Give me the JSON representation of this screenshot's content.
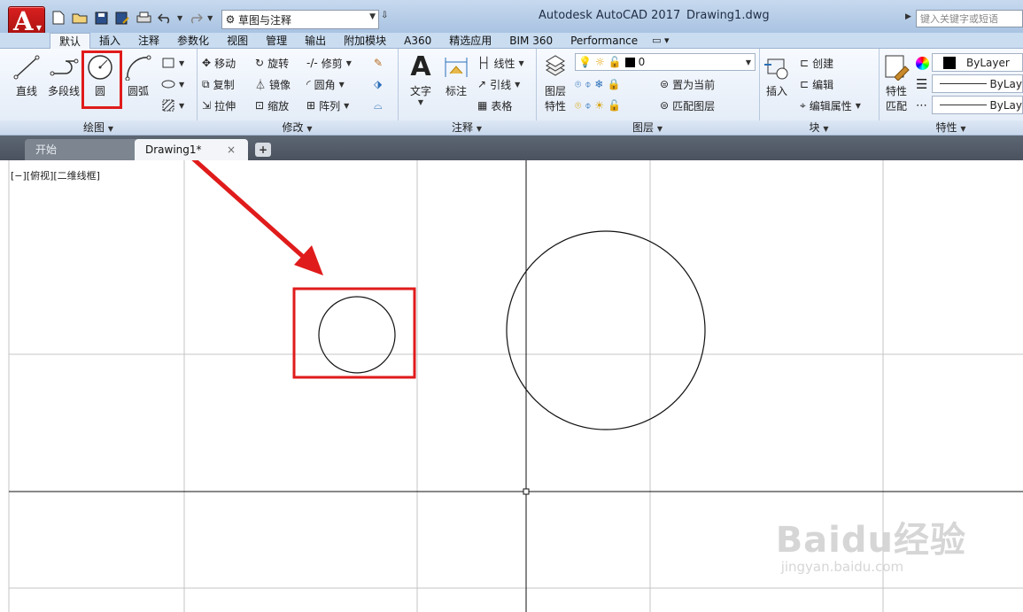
{
  "app": {
    "title": "Autodesk AutoCAD 2017",
    "document": "Drawing1.dwg",
    "workspace": "草图与注释",
    "search_placeholder": "键入关键字或短语",
    "app_button_letter": "A"
  },
  "ribbon_tabs": [
    "默认",
    "插入",
    "注释",
    "参数化",
    "视图",
    "管理",
    "输出",
    "附加模块",
    "A360",
    "精选应用",
    "BIM 360",
    "Performance"
  ],
  "active_tab": "默认",
  "panels": {
    "draw": {
      "title": "绘图",
      "line": "直线",
      "polyline": "多段线",
      "circle": "圆",
      "arc": "圆弧"
    },
    "modify": {
      "title": "修改",
      "move": "移动",
      "rotate": "旋转",
      "trim": "修剪",
      "copy": "复制",
      "mirror": "镜像",
      "fillet": "圆角",
      "stretch": "拉伸",
      "scale": "缩放",
      "array": "阵列"
    },
    "annotation": {
      "title": "注释",
      "text": "文字",
      "dimension": "标注",
      "linear": "线性",
      "leader": "引线",
      "table": "表格"
    },
    "layers": {
      "title": "图层",
      "properties_line1": "图层",
      "properties_line2": "特性",
      "current_layer": "0",
      "make_current": "置为当前",
      "match_layer": "匹配图层"
    },
    "block": {
      "title": "块",
      "insert": "插入",
      "create": "创建",
      "edit": "编辑",
      "edit_attributes": "编辑属性"
    },
    "properties": {
      "title": "特性",
      "match_line1": "特性",
      "match_line2": "匹配",
      "color": "ByLayer",
      "linetype": "ByLay",
      "lineweight": "ByLay"
    }
  },
  "file_tabs": {
    "start": "开始",
    "drawing": "Drawing1*",
    "close": "×",
    "add": "+"
  },
  "viewport_label": "[−][俯视][二维线框]",
  "watermark": {
    "logo": "Baidu经验",
    "url": "jingyan.baidu.com"
  },
  "colors": {
    "highlight": "#e01b1b",
    "app_button": "#c21818"
  }
}
